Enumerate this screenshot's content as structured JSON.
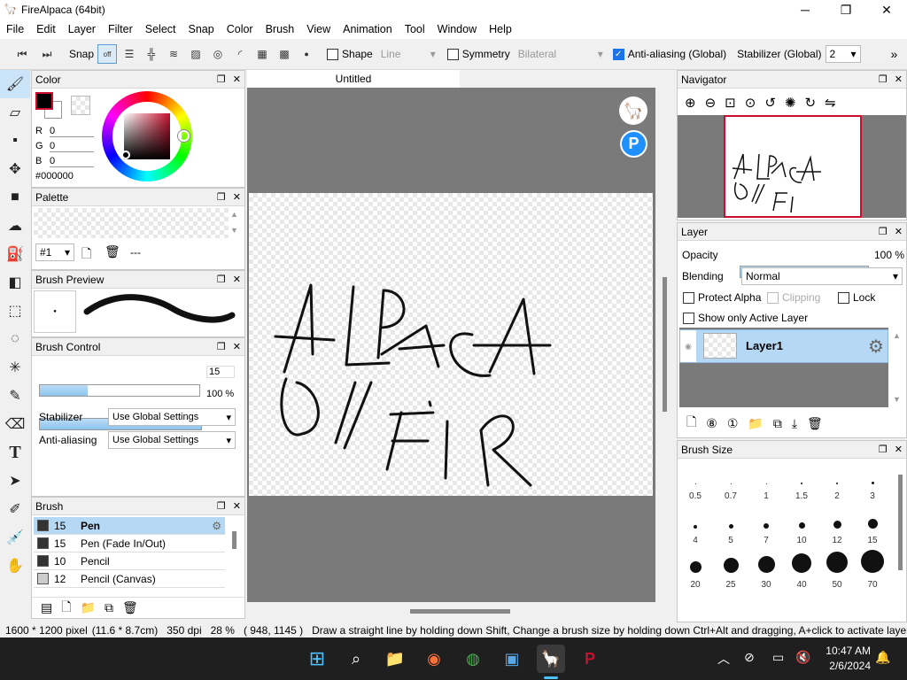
{
  "window": {
    "title": "FireAlpaca (64bit)",
    "minimize_icon": "─",
    "maximize_icon": "❐",
    "close_icon": "✕"
  },
  "menu": [
    "File",
    "Edit",
    "Layer",
    "Filter",
    "Select",
    "Snap",
    "Color",
    "Brush",
    "View",
    "Animation",
    "Tool",
    "Window",
    "Help"
  ],
  "toolbar": {
    "snap_label": "Snap",
    "snap_off": "off",
    "shape_label": "Shape",
    "shape_value": "Line",
    "symmetry_label": "Symmetry",
    "symmetry_value": "Bilateral",
    "antialias_label": "Anti-aliasing (Global)",
    "stabilizer_label": "Stabilizer (Global)",
    "stabilizer_value": "2",
    "more": "»"
  },
  "color_panel": {
    "title": "Color",
    "r_label": "R",
    "g_label": "G",
    "b_label": "B",
    "r": "0",
    "g": "0",
    "b": "0",
    "hex": "#000000"
  },
  "palette_panel": {
    "title": "Palette",
    "select_value": "#1",
    "name": "---"
  },
  "brush_preview_panel": {
    "title": "Brush Preview"
  },
  "brush_control_panel": {
    "title": "Brush Control",
    "size_value": "15",
    "size_fraction": 0.3,
    "opacity_value": "100 %",
    "opacity_fraction": 1.0,
    "stabilizer_label": "Stabilizer",
    "stabilizer_value": "Use Global Settings",
    "antialias_label": "Anti-aliasing",
    "antialias_value": "Use Global Settings"
  },
  "brush_panel": {
    "title": "Brush",
    "items": [
      {
        "size": "15",
        "name": "Pen",
        "selected": true
      },
      {
        "size": "15",
        "name": "Pen (Fade In/Out)",
        "selected": false
      },
      {
        "size": "10",
        "name": "Pencil",
        "selected": false
      },
      {
        "size": "12",
        "name": "Pencil (Canvas)",
        "selected": false
      }
    ]
  },
  "canvas": {
    "tab_title": "Untitled"
  },
  "navigator_panel": {
    "title": "Navigator"
  },
  "layer_panel": {
    "title": "Layer",
    "opacity_label": "Opacity",
    "opacity_value": "100 %",
    "opacity_fraction": 1.0,
    "blending_label": "Blending",
    "blending_value": "Normal",
    "protect_alpha": "Protect Alpha",
    "clipping": "Clipping",
    "lock": "Lock",
    "show_only_active": "Show only Active Layer",
    "layer_name": "Layer1"
  },
  "brush_size_panel": {
    "title": "Brush Size",
    "sizes": [
      "0.5",
      "0.7",
      "1",
      "1.5",
      "2",
      "3",
      "4",
      "5",
      "7",
      "10",
      "12",
      "15",
      "20",
      "25",
      "30",
      "40",
      "50",
      "70"
    ]
  },
  "status": {
    "dimensions": "1600 * 1200 pixel",
    "physical": "(11.6 * 8.7cm)",
    "dpi": "350 dpi",
    "zoom": "28 %",
    "coords": "( 948, 1145 )",
    "hint": "Draw a straight line by holding down Shift, Change a brush size by holding down Ctrl+Alt and dragging, A+click to activate layer"
  },
  "taskbar": {
    "time": "10:47 AM",
    "date": "2/6/2024"
  },
  "colors": {
    "accent": "#1a73e8",
    "selection": "#b5d8f5",
    "canvas_bg": "#7a7a7a",
    "taskbar": "#1f1f1f",
    "paint_red": "#c8102e"
  }
}
